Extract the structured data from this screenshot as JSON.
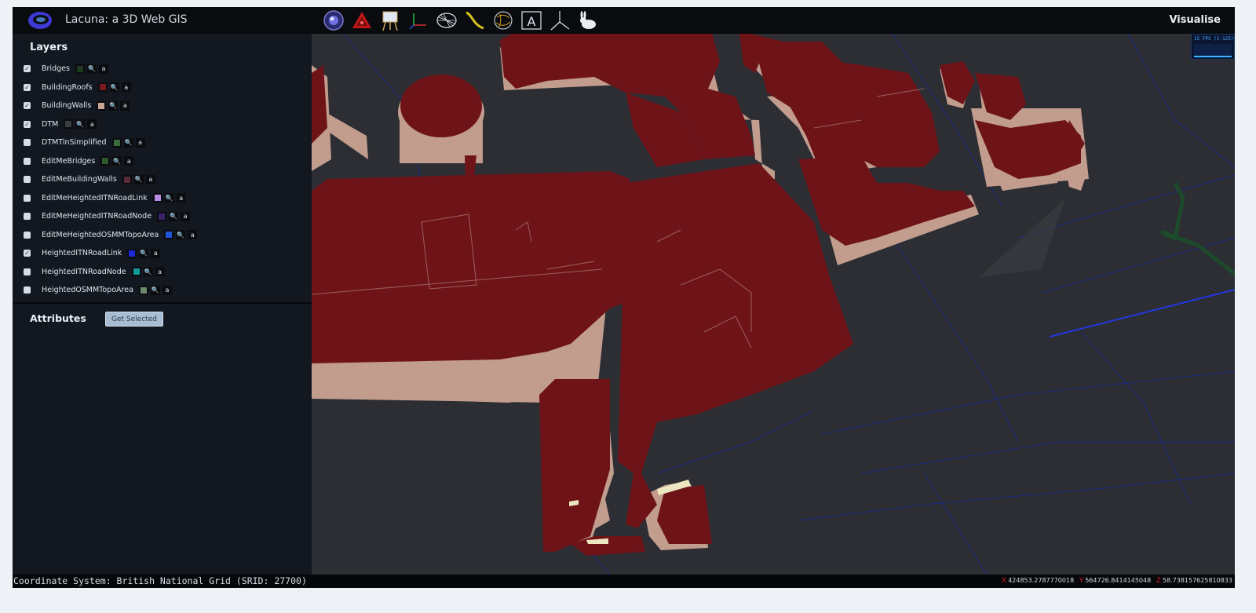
{
  "app": {
    "title": "Lacuna: a 3D Web GIS",
    "visualise_label": "Visualise"
  },
  "toolbar": [
    {
      "name": "globe-tool-icon"
    },
    {
      "name": "warning-triangle-tool-icon"
    },
    {
      "name": "easel-tool-icon"
    },
    {
      "name": "axes-tool-icon"
    },
    {
      "name": "wireframe-shell-tool-icon"
    },
    {
      "name": "curve-tool-icon"
    },
    {
      "name": "sketch-globe-tool-icon"
    },
    {
      "name": "text-tool-icon",
      "label": "A"
    },
    {
      "name": "xyz-axes-tool-icon"
    },
    {
      "name": "bunny-model-tool-icon"
    }
  ],
  "layers": {
    "title": "Layers",
    "items": [
      {
        "name": "Bridges",
        "checked": true,
        "color": "#1e3a1e"
      },
      {
        "name": "BuildingRoofs",
        "checked": true,
        "color": "#7b1a1e"
      },
      {
        "name": "BuildingWalls",
        "checked": true,
        "color": "#c9a595"
      },
      {
        "name": "DTM",
        "checked": true,
        "color": "#3a3c40"
      },
      {
        "name": "DTMTinSimplified",
        "checked": false,
        "color": "#3a6a3a"
      },
      {
        "name": "EditMeBridges",
        "checked": false,
        "color": "#2e5a2e"
      },
      {
        "name": "EditMeBuildingWalls",
        "checked": false,
        "color": "#5a2a34"
      },
      {
        "name": "EditMeHeightedITNRoadLink",
        "checked": false,
        "color": "#b88ee8"
      },
      {
        "name": "EditMeHeightedITNRoadNode",
        "checked": false,
        "color": "#3c2268"
      },
      {
        "name": "EditMeHeightedOSMMTopoArea",
        "checked": false,
        "color": "#1f55d6"
      },
      {
        "name": "HeightedITNRoadLink",
        "checked": true,
        "color": "#1b28d8"
      },
      {
        "name": "HeightedITNRoadNode",
        "checked": false,
        "color": "#119a9a"
      },
      {
        "name": "HeightedOSMMTopoArea",
        "checked": false,
        "color": "#6d8a6d"
      }
    ],
    "tool_glyph": "🔍",
    "attr_glyph": "a",
    "check_glyph": "✓"
  },
  "attributes": {
    "title": "Attributes",
    "button_label": "Get Selected"
  },
  "fps": {
    "label": "15 FPS (1-125)"
  },
  "status": {
    "coord_system": "Coordinate System: British National Grid (SRID: 27700)",
    "x_label": "X",
    "x_value": "424853.2787770018",
    "y_label": "Y",
    "y_value": "564726.8414145048",
    "z_label": "Z",
    "z_value": "58.738157625810833"
  },
  "colors": {
    "roof": "#6e1419",
    "wall": "#c29d8e",
    "ground": "#2c2e33",
    "road": "#1b2bb8",
    "bridge": "#1f3f29"
  }
}
